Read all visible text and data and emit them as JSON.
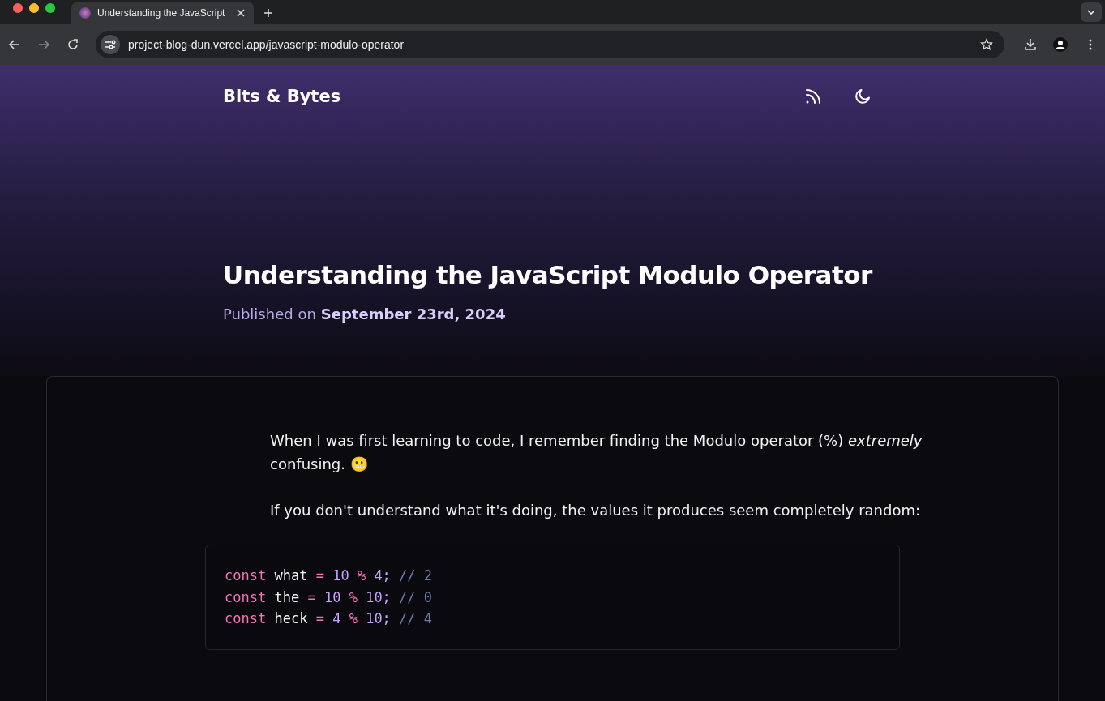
{
  "browser": {
    "tab": {
      "title": "Understanding the JavaScript"
    },
    "url": "project-blog-dun.vercel.app/javascript-modulo-operator"
  },
  "site": {
    "title": "Bits & Bytes"
  },
  "post": {
    "title": "Understanding the JavaScript Modulo Operator",
    "published_label": "Published on",
    "date": "September 23rd, 2024",
    "paragraphs": [
      "When I was first learning to code, I remember finding the Modulo operator (%) *extremely* confusing. 😬",
      "If you don't understand what it's doing, the values it produces seem completely random:"
    ],
    "code": [
      [
        {
          "kind": "keyword",
          "text": "const"
        },
        {
          "kind": "name",
          "text": "what"
        },
        {
          "kind": "operator",
          "text": "="
        },
        {
          "kind": "number",
          "text": "10"
        },
        {
          "kind": "operator",
          "text": "%"
        },
        {
          "kind": "number",
          "text": "4;"
        },
        {
          "kind": "comment",
          "text": "// 2"
        }
      ],
      [
        {
          "kind": "keyword",
          "text": "const"
        },
        {
          "kind": "name",
          "text": "the"
        },
        {
          "kind": "operator",
          "text": "="
        },
        {
          "kind": "number",
          "text": "10"
        },
        {
          "kind": "operator",
          "text": "%"
        },
        {
          "kind": "number",
          "text": "10;"
        },
        {
          "kind": "comment",
          "text": "// 0"
        }
      ],
      [
        {
          "kind": "keyword",
          "text": "const"
        },
        {
          "kind": "name",
          "text": "heck"
        },
        {
          "kind": "operator",
          "text": "="
        },
        {
          "kind": "number",
          "text": "4"
        },
        {
          "kind": "operator",
          "text": "%"
        },
        {
          "kind": "number",
          "text": "10;"
        },
        {
          "kind": "comment",
          "text": "// 4"
        }
      ]
    ]
  }
}
